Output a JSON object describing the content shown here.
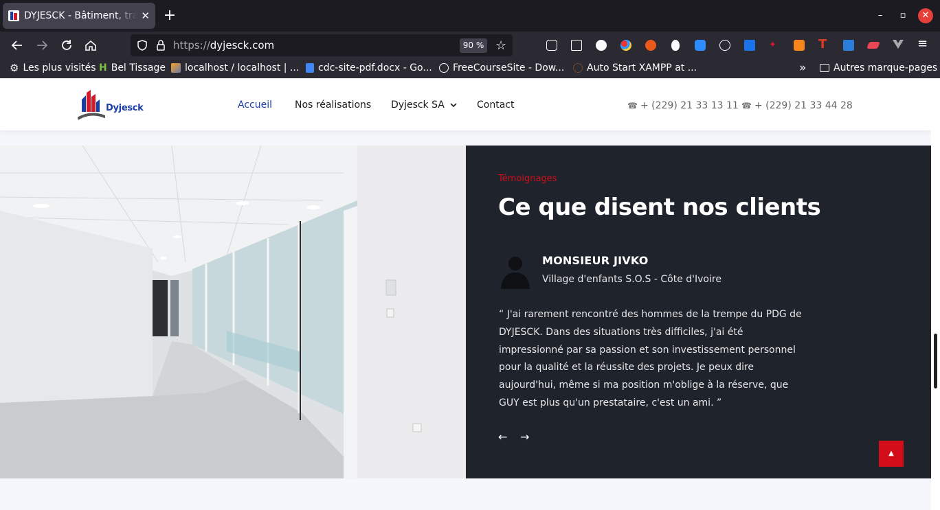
{
  "browser": {
    "tab_title": "DYJESCK - Bâtiment, travaux",
    "tab_close": "✕",
    "new_tab": "+",
    "url_scheme": "https://",
    "url_host": "dyjesck.com",
    "zoom": "90 %",
    "window_controls": {
      "minimize": "–",
      "maximize": "▫",
      "close": "✕"
    },
    "nav_icons": [
      "back-arrow-icon",
      "forward-arrow-icon",
      "reload-icon",
      "home-icon"
    ],
    "bookmarks": [
      {
        "label": "Les plus visités",
        "icon": "gear-icon"
      },
      {
        "label": "Bel Tissage",
        "icon": "h-favicon"
      },
      {
        "label": "localhost / localhost | ...",
        "icon": "phpmyadmin-favicon"
      },
      {
        "label": "cdc-site-pdf.docx - Go...",
        "icon": "docs-favicon"
      },
      {
        "label": "FreeCourseSite - Dow...",
        "icon": "globe-icon"
      },
      {
        "label": "Auto Start XAMPP at ...",
        "icon": "loading-icon"
      }
    ],
    "bookmarks_overflow": "»",
    "other_bookmarks": "Autres marque-pages",
    "accent": "#1c1b22"
  },
  "site": {
    "logo_text": "Dyjesck",
    "menu": [
      {
        "label": "Accueil",
        "active": true
      },
      {
        "label": "Nos réalisations"
      },
      {
        "label": "Dyjesck SA",
        "dropdown": true
      },
      {
        "label": "Contact"
      }
    ],
    "dropdown_chevron": "⌄",
    "phones": [
      "+ (229) 21 33 13 11",
      "+ (229) 21 33 44 28"
    ],
    "phone_icon": "☎"
  },
  "testimonial": {
    "kicker": "Témoignages",
    "heading": "Ce que disent nos clients",
    "name": "MONSIEUR JIVKO",
    "organization": "Village d'enfants S.O.S - Côte d'Ivoire",
    "quote": "“ J'ai rarement rencontré des hommes de la trempe du PDG de DYJESCK. Dans des situations très difficiles, j'ai été impressionné par sa passion et son investissement personnel pour la qualité et la réussite des projets. Je peux dire aujourd'hui, même si ma position m'oblige à la réserve, que GUY est plus qu'un prestataire, c'est un ami. ”",
    "prev_arrow": "←",
    "next_arrow": "→",
    "back_to_top": "▲"
  },
  "colors": {
    "brand_blue": "#1a3ea8",
    "brand_red": "#d40d1b",
    "dark_bg": "#1f232c"
  }
}
